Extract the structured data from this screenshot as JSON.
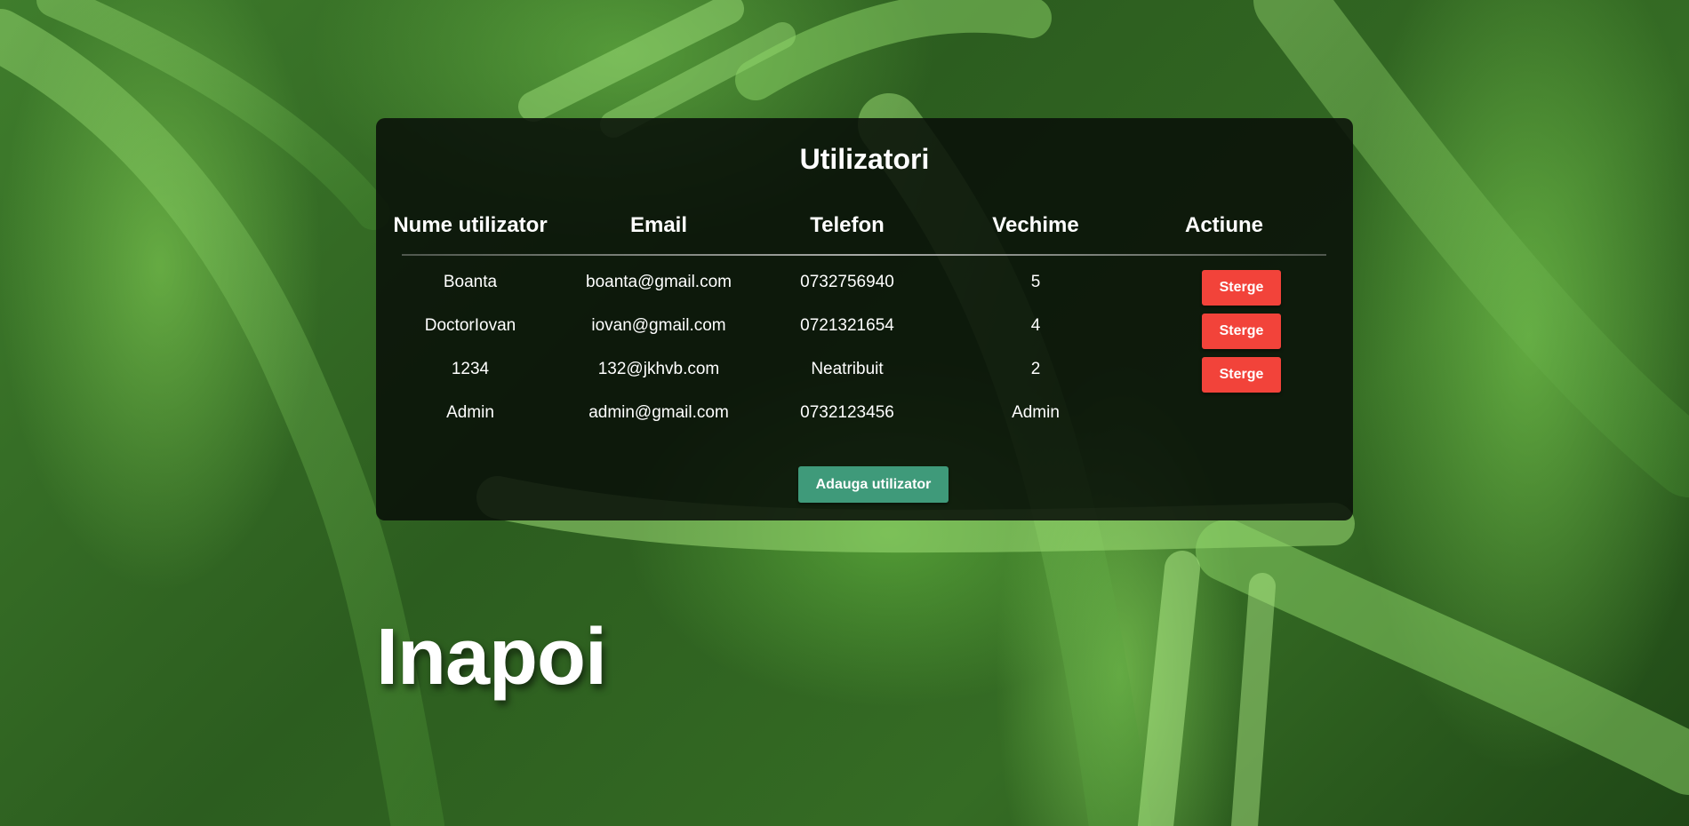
{
  "page": {
    "title": "Utilizatori",
    "back_label": "Inapoi",
    "add_button_label": "Adauga utilizator"
  },
  "table": {
    "headers": [
      "Nume utilizator",
      "Email",
      "Telefon",
      "Vechime",
      "Actiune"
    ],
    "rows": [
      {
        "name": "Boanta",
        "email": "boanta@gmail.com",
        "phone": "0732756940",
        "seniority": "5",
        "action": "Sterge"
      },
      {
        "name": "DoctorIovan",
        "email": "iovan@gmail.com",
        "phone": "0721321654",
        "seniority": "4",
        "action": "Sterge"
      },
      {
        "name": "1234",
        "email": "132@jkhvb.com",
        "phone": "Neatribuit",
        "seniority": "2",
        "action": "Sterge"
      },
      {
        "name": "Admin",
        "email": "admin@gmail.com",
        "phone": "0732123456",
        "seniority": "Admin",
        "action": ""
      }
    ]
  },
  "colors": {
    "delete_button": "#f2433a",
    "add_button": "#3f9a7a",
    "panel": "#080e08",
    "background": "#3f7d2c"
  }
}
